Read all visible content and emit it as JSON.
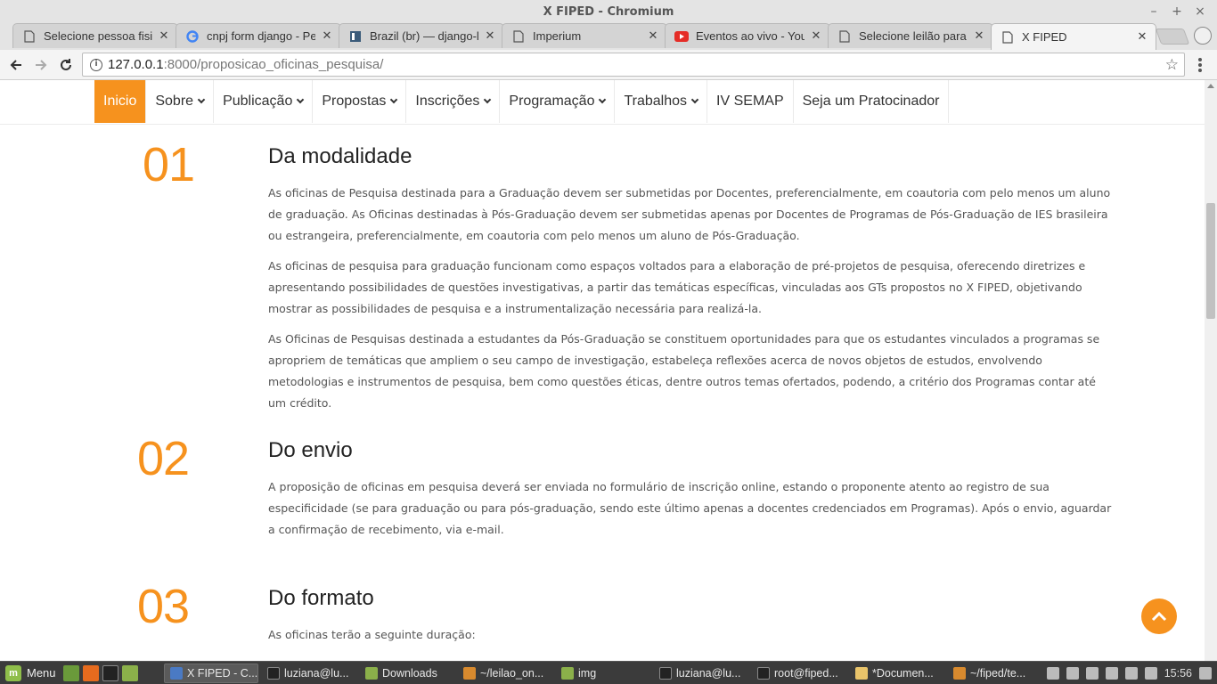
{
  "window": {
    "title": "X FIPED - Chromium"
  },
  "tabs": [
    {
      "label": "Selecione pessoa fisic",
      "icon": "page-icon"
    },
    {
      "label": "cnpj form django - Pes",
      "icon": "google-icon"
    },
    {
      "label": "Brazil (br) — django-lo",
      "icon": "docs-icon"
    },
    {
      "label": "Imperium",
      "icon": "page-icon"
    },
    {
      "label": "Eventos ao vivo - YouT",
      "icon": "youtube-icon"
    },
    {
      "label": "Selecione leilão para",
      "icon": "page-icon"
    },
    {
      "label": "X FIPED",
      "icon": "page-icon",
      "active": true
    }
  ],
  "address": {
    "host": "127.0.0.1",
    "path": ":8000/proposicao_oficinas_pesquisa/"
  },
  "sitenav": {
    "items": [
      {
        "label": "Inicio",
        "dropdown": false,
        "active": true
      },
      {
        "label": "Sobre",
        "dropdown": true
      },
      {
        "label": "Publicação",
        "dropdown": true
      },
      {
        "label": "Propostas",
        "dropdown": true
      },
      {
        "label": "Inscrições",
        "dropdown": true
      },
      {
        "label": "Programação",
        "dropdown": true
      },
      {
        "label": "Trabalhos",
        "dropdown": true
      },
      {
        "label": "IV SEMAP",
        "dropdown": false
      },
      {
        "label": "Seja um Pratocinador",
        "dropdown": false
      }
    ]
  },
  "sections": [
    {
      "number": "01",
      "title": "Da modalidade",
      "paragraphs": [
        "As oficinas de Pesquisa destinada para a Graduação devem ser submetidas por Docentes, preferencialmente, em coautoria com pelo menos um aluno de graduação. As Oficinas destinadas à Pós-Graduação devem ser submetidas apenas por Docentes de Programas de Pós-Graduação de IES brasileira ou estrangeira, preferencialmente, em coautoria com pelo menos um aluno de Pós-Graduação.",
        "As oficinas de pesquisa para graduação funcionam como espaços voltados para a elaboração de pré-projetos de pesquisa, oferecendo diretrizes e apresentando possibilidades de questões investigativas, a partir das temáticas específicas, vinculadas aos GTs propostos no X FIPED, objetivando mostrar as possibilidades de pesquisa e a instrumentalização necessária para realizá-la.",
        "As Oficinas de Pesquisas destinada a estudantes da Pós-Graduação se constituem oportunidades para que os estudantes vinculados a programas se apropriem de temáticas que ampliem o seu campo de investigação, estabeleça reflexões acerca de novos objetos de estudos, envolvendo metodologias e instrumentos de pesquisa, bem como questões éticas, dentre outros temas ofertados, podendo, a critério dos Programas contar até um crédito."
      ]
    },
    {
      "number": "02",
      "title": "Do envio",
      "paragraphs": [
        "A proposição de oficinas em pesquisa deverá ser enviada no formulário de inscrição online, estando o proponente atento ao registro de sua especificidade (se para graduação ou para pós-graduação, sendo este último apenas a docentes credenciados em Programas). Após o envio, aguardar a confirmação de recebimento, via e-mail."
      ]
    },
    {
      "number": "03",
      "title": "Do formato",
      "paragraphs": [
        "As oficinas terão a seguinte duração:"
      ]
    }
  ],
  "taskbar": {
    "menu_label": "Menu",
    "windows": [
      {
        "label": "X FIPED - C...",
        "active": true
      },
      {
        "label": "luziana@lu..."
      },
      {
        "label": "Downloads"
      },
      {
        "label": "~/leilao_on..."
      },
      {
        "label": "img"
      },
      {
        "label": "luziana@lu..."
      },
      {
        "label": "root@fiped..."
      },
      {
        "label": "*Documen..."
      },
      {
        "label": "~/fiped/te..."
      }
    ],
    "clock": "15:56"
  },
  "colors": {
    "accent": "#f6921e"
  }
}
